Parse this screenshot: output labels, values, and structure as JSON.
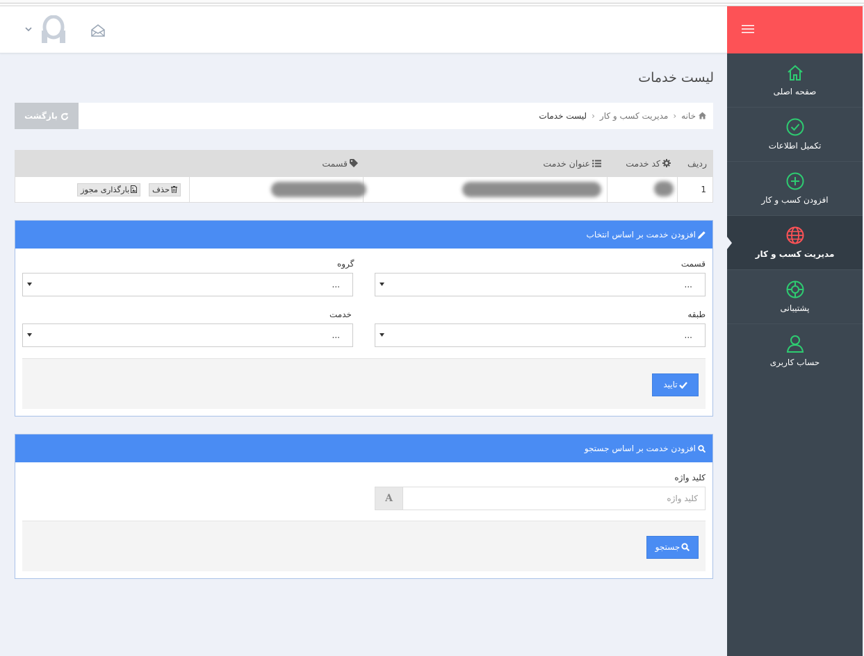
{
  "page": {
    "title": "لیست خدمات"
  },
  "breadcrumb": {
    "home": "خانه",
    "section": "مدیریت کسب و کار",
    "current": "لیست خدمات"
  },
  "back_button": "بازگشت",
  "sidebar": {
    "items": [
      {
        "label": "صفحه اصلی",
        "icon": "home-icon"
      },
      {
        "label": "تکمیل اطلاعات",
        "icon": "check-circle-icon"
      },
      {
        "label": "افزودن کسب و کار",
        "icon": "plus-circle-icon"
      },
      {
        "label": "مدیریت کسب و کار",
        "icon": "globe-icon",
        "active": true
      },
      {
        "label": "پشتیبانی",
        "icon": "life-ring-icon"
      },
      {
        "label": "حساب کاربری",
        "icon": "user-icon"
      }
    ]
  },
  "table": {
    "headers": {
      "row": "ردیف",
      "code": "کد خدمت",
      "title": "عنوان خدمت",
      "section": "قسمت"
    },
    "rows": [
      {
        "row": "1"
      }
    ],
    "actions": {
      "delete": "حذف",
      "upload": "بارگذاری مجوز"
    }
  },
  "select_panel": {
    "title": "افزودن خدمت بر اساس انتخاب",
    "fields": {
      "section": {
        "label": "قسمت",
        "value": "..."
      },
      "group": {
        "label": "گروه",
        "value": "..."
      },
      "category": {
        "label": "طبقه",
        "value": "..."
      },
      "service": {
        "label": "خدمت",
        "value": "..."
      }
    },
    "submit": "تایید"
  },
  "search_panel": {
    "title": "افزودن خدمت بر اساس جستجو",
    "keyword_label": "کلید واژه",
    "keyword_placeholder": "کلید واژه",
    "addon": "A",
    "submit": "جستجو"
  },
  "colors": {
    "brand": "#fd5256",
    "sidebar": "#3c4751",
    "primary": "#4a8cf3",
    "nav_icon": "#2ecc71"
  }
}
